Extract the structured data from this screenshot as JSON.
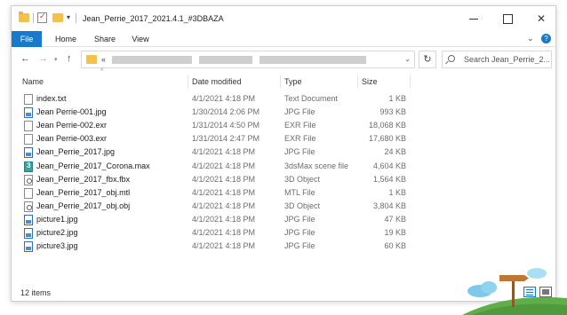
{
  "window": {
    "title": "Jean_Perrie_2017_2021.4.1_#3DBAZA"
  },
  "ribbon": {
    "tabs": [
      "File",
      "Home",
      "Share",
      "View"
    ],
    "help": "?"
  },
  "address": {
    "path_prefix": "«",
    "refresh_glyph": "↻"
  },
  "search": {
    "placeholder": "Search Jean_Perrie_2..."
  },
  "columns": {
    "name": "Name",
    "date": "Date modified",
    "type": "Type",
    "size": "Size"
  },
  "files": [
    {
      "name": "index.txt",
      "date": "4/1/2021 4:18 PM",
      "type": "Text Document",
      "size": "1 KB",
      "icon": "text-file-icon"
    },
    {
      "name": "Jean Perrie-001.jpg",
      "date": "1/30/2014 2:06 PM",
      "type": "JPG File",
      "size": "993 KB",
      "icon": "image-file-icon"
    },
    {
      "name": "Jean Perrie-002.exr",
      "date": "1/31/2014 4:50 PM",
      "type": "EXR File",
      "size": "18,068 KB",
      "icon": "generic-file-icon"
    },
    {
      "name": "Jean Perrie-003.exr",
      "date": "1/31/2014 2:47 PM",
      "type": "EXR File",
      "size": "17,680 KB",
      "icon": "generic-file-icon"
    },
    {
      "name": "Jean_Perrie_2017.jpg",
      "date": "4/1/2021 4:18 PM",
      "type": "JPG File",
      "size": "24 KB",
      "icon": "image-file-icon"
    },
    {
      "name": "Jean_Perrie_2017_Corona.max",
      "date": "4/1/2021 4:18 PM",
      "type": "3dsMax scene file",
      "size": "4,604 KB",
      "icon": "3dsmax-file-icon"
    },
    {
      "name": "Jean_Perrie_2017_fbx.fbx",
      "date": "4/1/2021 4:18 PM",
      "type": "3D Object",
      "size": "1,564 KB",
      "icon": "3d-object-icon"
    },
    {
      "name": "Jean_Perrie_2017_obj.mtl",
      "date": "4/1/2021 4:18 PM",
      "type": "MTL File",
      "size": "1 KB",
      "icon": "generic-file-icon"
    },
    {
      "name": "Jean_Perrie_2017_obj.obj",
      "date": "4/1/2021 4:18 PM",
      "type": "3D Object",
      "size": "3,804 KB",
      "icon": "3d-object-icon"
    },
    {
      "name": "picture1.jpg",
      "date": "4/1/2021 4:18 PM",
      "type": "JPG File",
      "size": "47 KB",
      "icon": "image-file-icon"
    },
    {
      "name": "picture2.jpg",
      "date": "4/1/2021 4:18 PM",
      "type": "JPG File",
      "size": "19 KB",
      "icon": "image-file-icon"
    },
    {
      "name": "picture3.jpg",
      "date": "4/1/2021 4:18 PM",
      "type": "JPG File",
      "size": "60 KB",
      "icon": "image-file-icon"
    }
  ],
  "status": {
    "items": "12 items"
  },
  "colors": {
    "accent": "#1979ca",
    "folder": "#f3c24a"
  }
}
